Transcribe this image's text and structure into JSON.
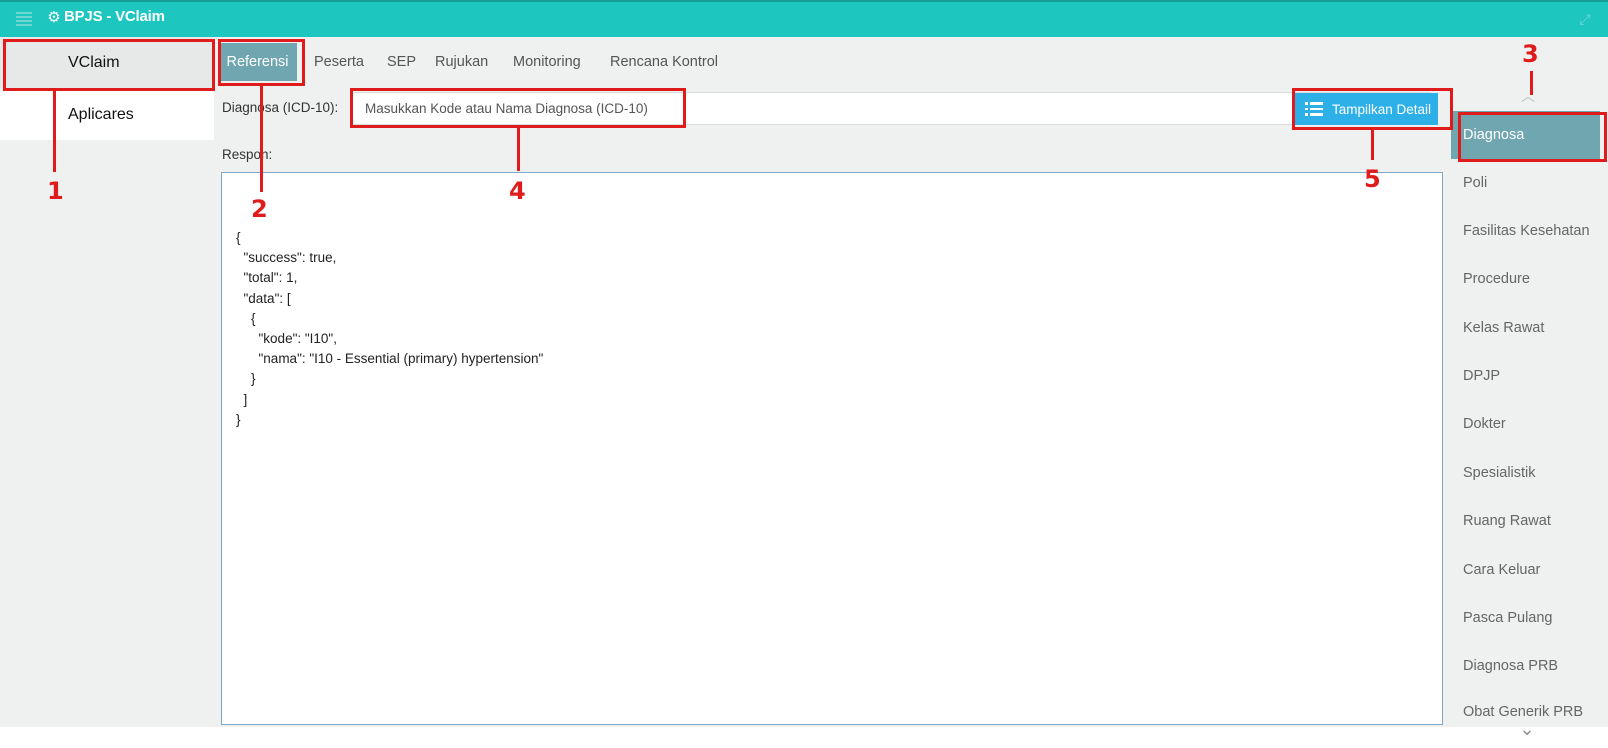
{
  "app": {
    "title": "BPJS - VClaim"
  },
  "left_nav": [
    {
      "label": "VClaim",
      "selected": true
    },
    {
      "label": "Aplicares",
      "selected": false
    }
  ],
  "tabs": [
    {
      "label": "Referensi",
      "active": true
    },
    {
      "label": "Peserta"
    },
    {
      "label": "SEP"
    },
    {
      "label": "Rujukan"
    },
    {
      "label": "Monitoring"
    },
    {
      "label": "Rencana Kontrol"
    }
  ],
  "form": {
    "diagnosa_label": "Diagnosa (ICD-10):",
    "diagnosa_placeholder": "Masukkan Kode atau Nama Diagnosa (ICD-10)",
    "detail_button": "Tampilkan Detail",
    "respon_label": "Respon:"
  },
  "response_text": "{\n  \"success\": true,\n  \"total\": 1,\n  \"data\": [\n    {\n      \"kode\": \"I10\",\n      \"nama\": \"I10 - Essential (primary) hypertension\"\n    }\n  ]\n}",
  "right_nav": [
    {
      "label": "Diagnosa",
      "active": true
    },
    {
      "label": "Poli"
    },
    {
      "label": "Fasilitas Kesehatan"
    },
    {
      "label": "Procedure"
    },
    {
      "label": "Kelas Rawat"
    },
    {
      "label": "DPJP"
    },
    {
      "label": "Dokter"
    },
    {
      "label": "Spesialistik"
    },
    {
      "label": "Ruang Rawat"
    },
    {
      "label": "Cara Keluar"
    },
    {
      "label": "Pasca Pulang"
    },
    {
      "label": "Diagnosa PRB"
    },
    {
      "label": "Obat Generik PRB"
    }
  ],
  "annotations": [
    "1",
    "2",
    "3",
    "4",
    "5"
  ],
  "colors": {
    "titlebar": "#1ec6c0",
    "active_tab": "#6fa6b0",
    "button": "#2db0e8",
    "annotation": "#e01b1b"
  }
}
